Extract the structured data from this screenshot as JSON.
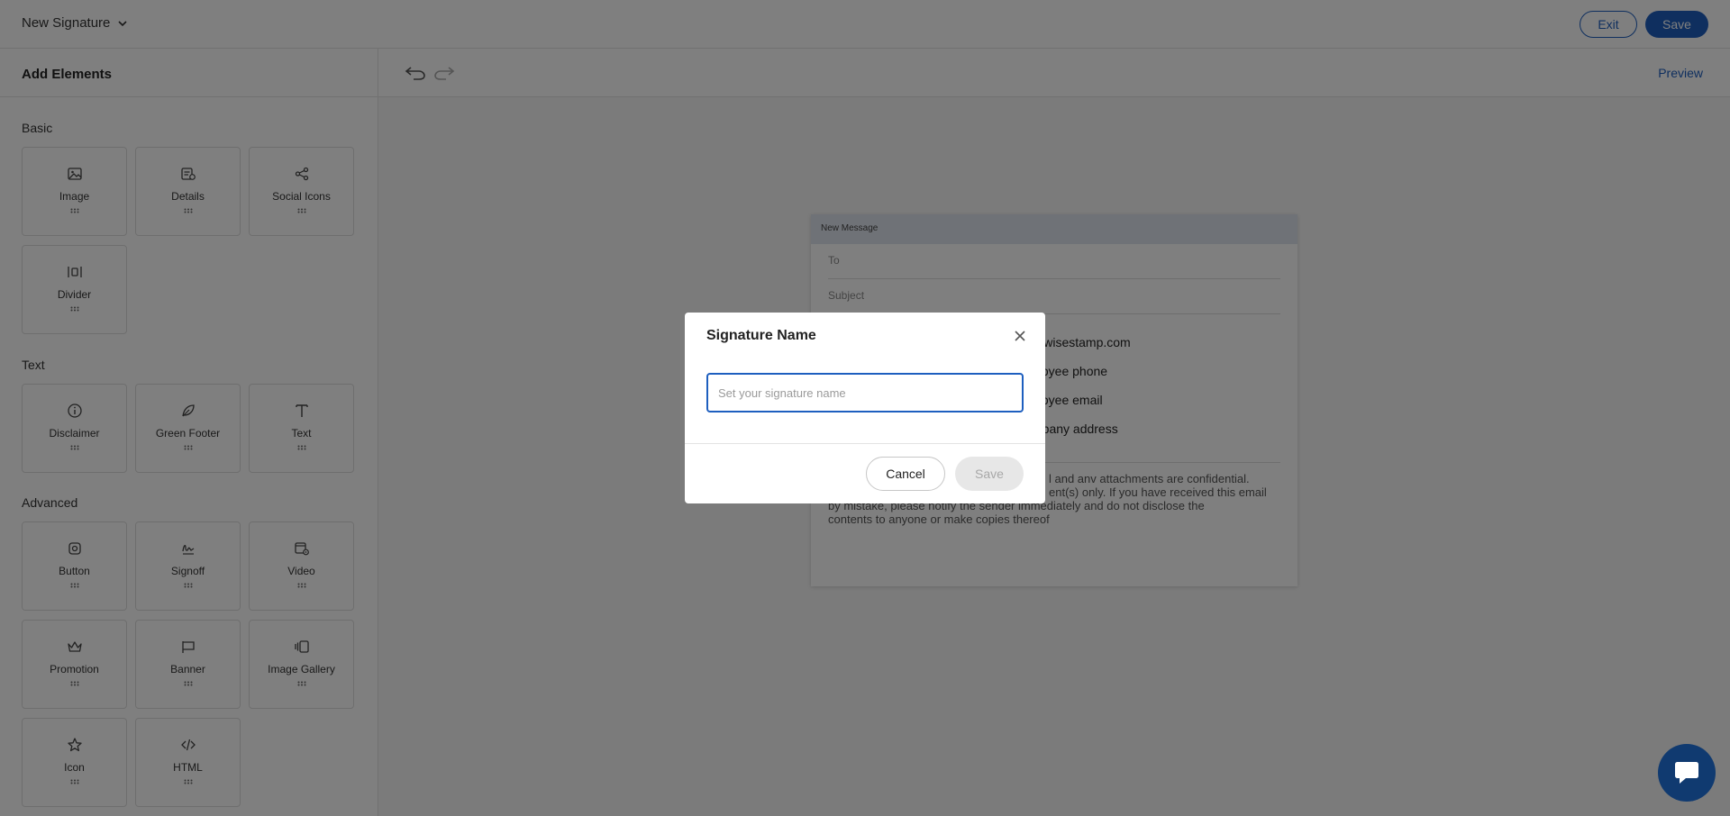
{
  "topbar": {
    "signature_title": "New Signature",
    "exit_label": "Exit",
    "save_label": "Save"
  },
  "sidebar": {
    "header": "Add Elements",
    "sections": {
      "basic": "Basic",
      "text": "Text",
      "advanced": "Advanced"
    },
    "tiles": {
      "image": "Image",
      "details": "Details",
      "social_icons": "Social Icons",
      "divider": "Divider",
      "disclaimer": "Disclaimer",
      "green_footer": "Green Footer",
      "text": "Text",
      "button": "Button",
      "signoff": "Signoff",
      "video": "Video",
      "promotion": "Promotion",
      "banner": "Banner",
      "image_gallery": "Image Gallery",
      "icon": "Icon",
      "html": "HTML"
    }
  },
  "canvas": {
    "preview_label": "Preview",
    "email": {
      "header": "New Message",
      "to_label": "To",
      "subject_label": "Subject",
      "signature_lines": [
        "w.wisestamp.com",
        "ployee phone",
        "ployee email",
        "mpany address"
      ],
      "disclaimer_lines": [
        "l and anv attachments are confidential.",
        "ent(s) only. If you have received this email",
        "by mistake, please notify the sender immediately and do not disclose the",
        "contents to anyone or make copies thereof"
      ]
    }
  },
  "modal": {
    "title": "Signature Name",
    "input_placeholder": "Set your signature name",
    "input_value": "",
    "cancel_label": "Cancel",
    "save_label": "Save"
  },
  "colors": {
    "accent": "#1e5fbf",
    "chat_bubble": "#103a70",
    "overlay": "rgba(0,0,0,0.5)"
  }
}
